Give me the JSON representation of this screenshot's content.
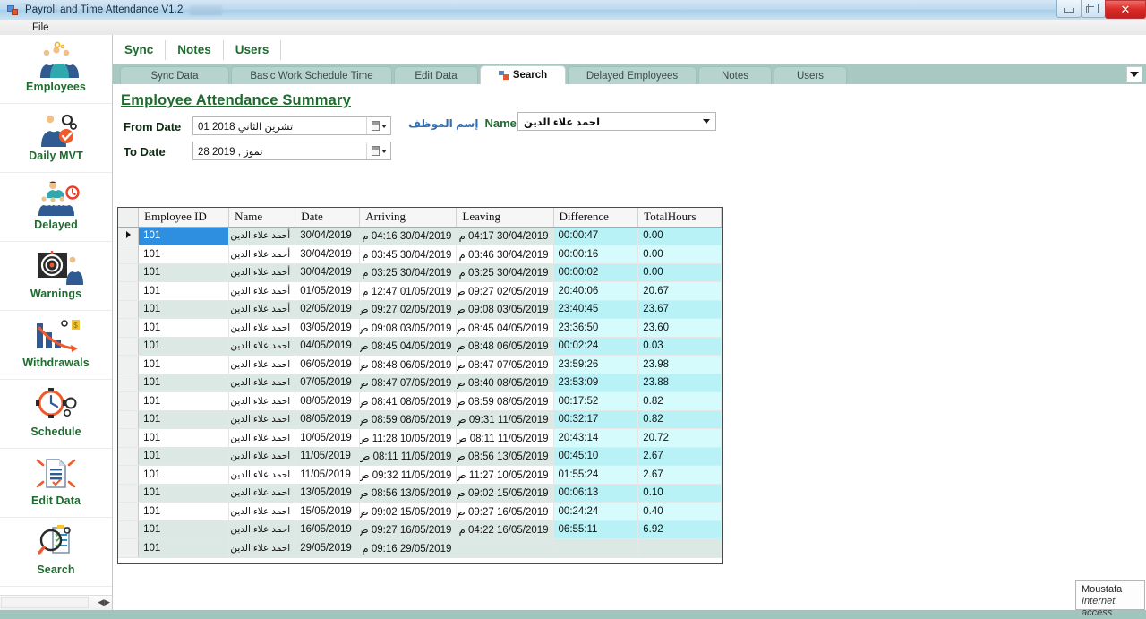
{
  "window": {
    "title": "Payroll and Time Attendance V1.2",
    "icon": "app-icon",
    "minimize_label": "Minimize",
    "maximize_label": "Restore",
    "close_label": "Close"
  },
  "menubar": {
    "items": [
      {
        "label": "File"
      }
    ]
  },
  "sidebar": {
    "items": [
      {
        "label": "Employees",
        "icon": "employees-group-icon"
      },
      {
        "label": "Daily MVT",
        "icon": "daily-movement-icon"
      },
      {
        "label": "Delayed",
        "icon": "delayed-people-icon"
      },
      {
        "label": "Warnings",
        "icon": "warnings-target-icon"
      },
      {
        "label": "Withdrawals",
        "icon": "withdrawals-chart-icon"
      },
      {
        "label": "Schedule",
        "icon": "schedule-clock-icon"
      },
      {
        "label": "Edit Data",
        "icon": "edit-data-document-icon"
      },
      {
        "label": "Search",
        "icon": "search-magnifier-icon"
      }
    ]
  },
  "top_tabs": [
    {
      "label": "Sync"
    },
    {
      "label": "Notes"
    },
    {
      "label": "Users"
    }
  ],
  "tab_strip": {
    "tabs": [
      {
        "label": "Sync Data",
        "active": false
      },
      {
        "label": "Basic Work Schedule Time",
        "active": false
      },
      {
        "label": "Edit Data",
        "active": false
      },
      {
        "label": "Search",
        "active": true,
        "icon": "window-tile-icon"
      },
      {
        "label": "Delayed Employees",
        "active": false
      },
      {
        "label": "Notes",
        "active": false
      },
      {
        "label": "Users",
        "active": false
      }
    ],
    "overflow_icon": "chevron-down-icon"
  },
  "form": {
    "title": "Employee Attendance Summary",
    "from_date_label": "From Date",
    "from_date_value": "01 تشرين الثاني 2018",
    "to_date_label": "To Date",
    "to_date_value": "28    تموز ,  2019",
    "name_label_en": "Name /",
    "name_label_ar": "إسم الموظف",
    "name_value": "احمد علاء الدين",
    "calendar_icon": "calendar-icon",
    "dropdown_icon": "chevron-down-icon"
  },
  "grid": {
    "columns": [
      "Employee ID",
      "Name",
      "Date",
      "Arriving",
      "Leaving",
      "Difference",
      "TotalHours"
    ],
    "selected_row": 0,
    "selected_column": "Employee ID",
    "rows": [
      {
        "id": "101",
        "name": "أحمد علاء الدين",
        "date": "30/04/2019",
        "arriving": "30/04/2019 04:16 م",
        "leaving": "30/04/2019 04:17 م",
        "difference": "00:00:47",
        "total": "0.00"
      },
      {
        "id": "101",
        "name": "أحمد علاء الدين",
        "date": "30/04/2019",
        "arriving": "30/04/2019 03:45 م",
        "leaving": "30/04/2019 03:46 م",
        "difference": "00:00:16",
        "total": "0.00"
      },
      {
        "id": "101",
        "name": "أحمد علاء الدين",
        "date": "30/04/2019",
        "arriving": "30/04/2019 03:25 م",
        "leaving": "30/04/2019 03:25 م",
        "difference": "00:00:02",
        "total": "0.00"
      },
      {
        "id": "101",
        "name": "أحمد علاء الدين",
        "date": "01/05/2019",
        "arriving": "01/05/2019 12:47 م",
        "leaving": "02/05/2019 09:27 ص",
        "difference": "20:40:06",
        "total": "20.67"
      },
      {
        "id": "101",
        "name": "أحمد علاء الدين",
        "date": "02/05/2019",
        "arriving": "02/05/2019 09:27 ص",
        "leaving": "03/05/2019 09:08 ص",
        "difference": "23:40:45",
        "total": "23.67"
      },
      {
        "id": "101",
        "name": "احمد علاء الدين",
        "date": "03/05/2019",
        "arriving": "03/05/2019 09:08 ص",
        "leaving": "04/05/2019 08:45 ص",
        "difference": "23:36:50",
        "total": "23.60"
      },
      {
        "id": "101",
        "name": "احمد علاء الدين",
        "date": "04/05/2019",
        "arriving": "04/05/2019 08:45 ص",
        "leaving": "06/05/2019 08:48 ص",
        "difference": "00:02:24",
        "total": "0.03"
      },
      {
        "id": "101",
        "name": "احمد علاء الدين",
        "date": "06/05/2019",
        "arriving": "06/05/2019 08:48 ص",
        "leaving": "07/05/2019 08:47 ص",
        "difference": "23:59:26",
        "total": "23.98"
      },
      {
        "id": "101",
        "name": "احمد علاء الدين",
        "date": "07/05/2019",
        "arriving": "07/05/2019 08:47 ص",
        "leaving": "08/05/2019 08:40 ص",
        "difference": "23:53:09",
        "total": "23.88"
      },
      {
        "id": "101",
        "name": "احمد علاء الدين",
        "date": "08/05/2019",
        "arriving": "08/05/2019 08:41 ص",
        "leaving": "08/05/2019 08:59 ص",
        "difference": "00:17:52",
        "total": "0.82"
      },
      {
        "id": "101",
        "name": "احمد علاء الدين",
        "date": "08/05/2019",
        "arriving": "08/05/2019 08:59 ص",
        "leaving": "11/05/2019 09:31 ص",
        "difference": "00:32:17",
        "total": "0.82"
      },
      {
        "id": "101",
        "name": "احمد علاء الدين",
        "date": "10/05/2019",
        "arriving": "10/05/2019 11:28 ص",
        "leaving": "11/05/2019 08:11 ص",
        "difference": "20:43:14",
        "total": "20.72"
      },
      {
        "id": "101",
        "name": "احمد علاء الدين",
        "date": "11/05/2019",
        "arriving": "11/05/2019 08:11 ص",
        "leaving": "13/05/2019 08:56 ص",
        "difference": "00:45:10",
        "total": "2.67"
      },
      {
        "id": "101",
        "name": "احمد علاء الدين",
        "date": "11/05/2019",
        "arriving": "11/05/2019 09:32 ص",
        "leaving": "10/05/2019 11:27 ص",
        "difference": "01:55:24",
        "total": "2.67"
      },
      {
        "id": "101",
        "name": "احمد علاء الدين",
        "date": "13/05/2019",
        "arriving": "13/05/2019 08:56 ص",
        "leaving": "15/05/2019 09:02 ص",
        "difference": "00:06:13",
        "total": "0.10"
      },
      {
        "id": "101",
        "name": "احمد علاء الدين",
        "date": "15/05/2019",
        "arriving": "15/05/2019 09:02 ص",
        "leaving": "16/05/2019 09:27 ص",
        "difference": "00:24:24",
        "total": "0.40"
      },
      {
        "id": "101",
        "name": "احمد علاء الدين",
        "date": "16/05/2019",
        "arriving": "16/05/2019 09:27 ص",
        "leaving": "16/05/2019 04:22 م",
        "difference": "06:55:11",
        "total": "6.92"
      },
      {
        "id": "101",
        "name": "احمد علاء الدين",
        "date": "29/05/2019",
        "arriving": "29/05/2019 09:16 م",
        "leaving": "",
        "difference": "",
        "total": ""
      }
    ]
  },
  "tooltip": {
    "line1": "Moustafa",
    "line2": "Internet access"
  },
  "colors": {
    "accent_green": "#1f6b2f",
    "panel_teal": "#9fc5bc",
    "grid_highlight": "#b8f2f6",
    "row_alt": "#dce8e4",
    "selection_blue": "#2e8fe0"
  }
}
